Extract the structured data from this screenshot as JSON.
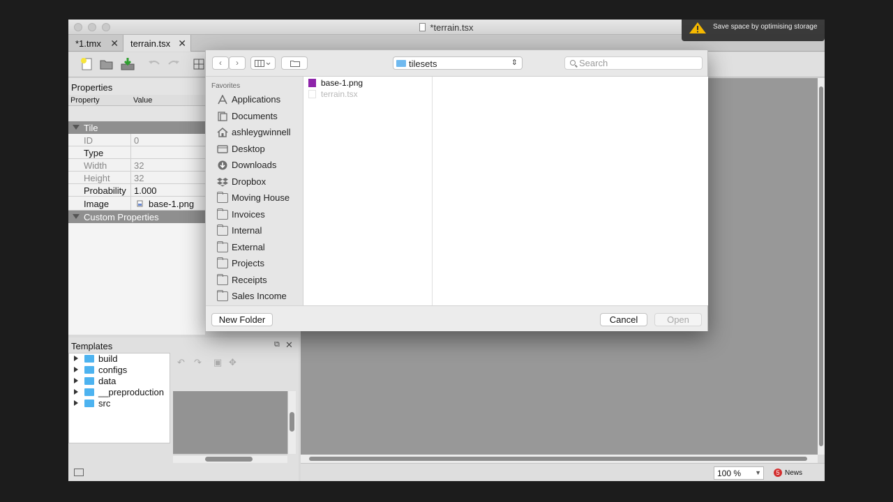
{
  "window": {
    "title": "*terrain.tsx"
  },
  "tabs": [
    {
      "label": "*1.tmx"
    },
    {
      "label": "terrain.tsx"
    }
  ],
  "properties": {
    "title": "Properties",
    "col_property": "Property",
    "col_value": "Value",
    "group_tile": "Tile",
    "rows": [
      {
        "key": "ID",
        "value": "0"
      },
      {
        "key": "Type",
        "value": ""
      },
      {
        "key": "Width",
        "value": "32"
      },
      {
        "key": "Height",
        "value": "32"
      },
      {
        "key": "Probability",
        "value": "1.000"
      },
      {
        "key": "Image",
        "value": "base-1.png"
      }
    ],
    "group_custom": "Custom Properties"
  },
  "templates": {
    "title": "Templates",
    "tree": [
      {
        "name": "build"
      },
      {
        "name": "configs"
      },
      {
        "name": "data"
      },
      {
        "name": "__preproduction"
      },
      {
        "name": "src"
      }
    ]
  },
  "statusbar": {
    "zoom": "100 %",
    "news_count": "5",
    "news_label": "News"
  },
  "dialog": {
    "location": "tilesets",
    "search_placeholder": "Search",
    "favorites_title": "Favorites",
    "favorites": [
      {
        "label": "Applications",
        "icon": "applications-icon"
      },
      {
        "label": "Documents",
        "icon": "documents-icon"
      },
      {
        "label": "ashleygwinnell",
        "icon": "home-icon"
      },
      {
        "label": "Desktop",
        "icon": "desktop-icon"
      },
      {
        "label": "Downloads",
        "icon": "downloads-icon"
      },
      {
        "label": "Dropbox",
        "icon": "dropbox-icon"
      },
      {
        "label": "Moving House",
        "icon": "folder-icon"
      },
      {
        "label": "Invoices",
        "icon": "folder-icon"
      },
      {
        "label": "Internal",
        "icon": "folder-icon"
      },
      {
        "label": "External",
        "icon": "folder-icon"
      },
      {
        "label": "Projects",
        "icon": "folder-icon"
      },
      {
        "label": "Receipts",
        "icon": "folder-icon"
      },
      {
        "label": "Sales Income",
        "icon": "folder-icon"
      }
    ],
    "files": [
      {
        "name": "base-1.png",
        "enabled": true
      },
      {
        "name": "terrain.tsx",
        "enabled": false
      }
    ],
    "new_folder": "New Folder",
    "cancel": "Cancel",
    "open": "Open"
  },
  "notification": {
    "text": "Save space by optimising storage"
  },
  "colors": {
    "accent_folder": "#4db3f0",
    "png_icon": "#8e24aa",
    "group_header": "#8f8f8f",
    "warning": "#f5b800"
  }
}
